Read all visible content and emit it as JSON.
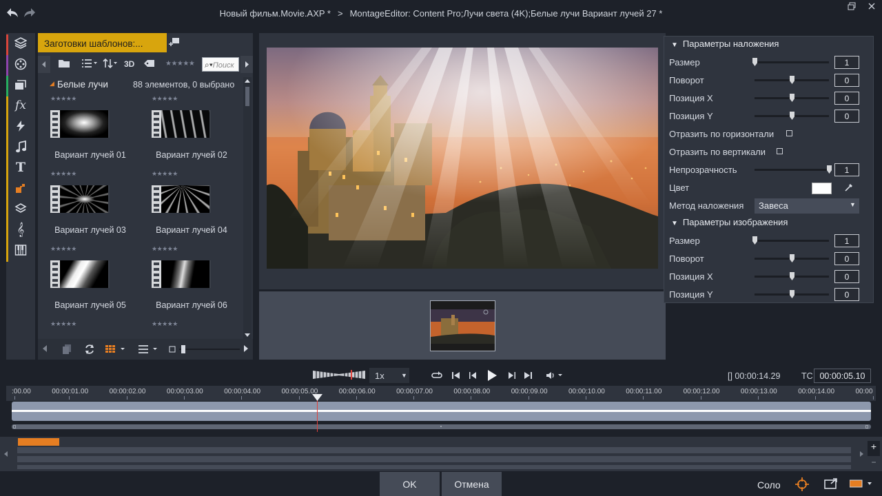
{
  "titlebar": {
    "project": "Новый фильм.Movie.AXP *",
    "editor": "MontageEditor: Content Pro;Лучи света (4K);Белые лучи  Вариант лучей 27 *"
  },
  "library": {
    "tab_label": "Заготовки шаблонов:...",
    "mode_3d": "3D",
    "search_placeholder": "Поиск",
    "folder_name": "Белые лучи",
    "count_text": "88 элементов, 0 выбрано",
    "items": [
      {
        "label": "Вариант лучей 01"
      },
      {
        "label": "Вариант лучей 02"
      },
      {
        "label": "Вариант лучей 03"
      },
      {
        "label": "Вариант лучей 04"
      },
      {
        "label": "Вариант лучей 05"
      },
      {
        "label": "Вариант лучей 06"
      }
    ]
  },
  "overlay_params": {
    "title": "Параметры наложения",
    "size": {
      "label": "Размер",
      "value": "1"
    },
    "rotation": {
      "label": "Поворот",
      "value": "0"
    },
    "pos_x": {
      "label": "Позиция X",
      "value": "0"
    },
    "pos_y": {
      "label": "Позиция Y",
      "value": "0"
    },
    "flip_h": {
      "label": "Отразить по горизонтали",
      "checked": false
    },
    "flip_v": {
      "label": "Отразить по вертикали",
      "checked": false
    },
    "opacity": {
      "label": "Непрозрачность",
      "value": "1"
    },
    "color": {
      "label": "Цвет",
      "value": "#ffffff"
    },
    "blend": {
      "label": "Метод наложения",
      "value": "Завеса"
    }
  },
  "image_params": {
    "title": "Параметры изображения",
    "size": {
      "label": "Размер",
      "value": "1"
    },
    "rotation": {
      "label": "Поворот",
      "value": "0"
    },
    "pos_x": {
      "label": "Позиция X",
      "value": "0"
    },
    "pos_y": {
      "label": "Позиция Y",
      "value": "0"
    }
  },
  "transport": {
    "speed": "1x",
    "duration": "[] 00:00:14.29",
    "tc_label": "TC",
    "timecode": "00:00:05.10"
  },
  "timeline": {
    "ticks": [
      ":00.00",
      "00:00:01.00",
      "00:00:02.00",
      "00:00:03.00",
      "00:00:04.00",
      "00:00:05.00",
      "00:00:06.00",
      "00:00:07.00",
      "00:00:08.00",
      "00:00:09.00",
      "00:00:10.00",
      "00:00:11.00",
      "00:00:12.00",
      "00:00:13.00",
      "00:00:14.00",
      "00:00"
    ]
  },
  "buttons": {
    "ok": "OK",
    "cancel": "Отмена",
    "solo": "Соло"
  },
  "colors": {
    "accent": "#d8a50d",
    "playhead": "#e0413b",
    "orange": "#e67e22"
  }
}
